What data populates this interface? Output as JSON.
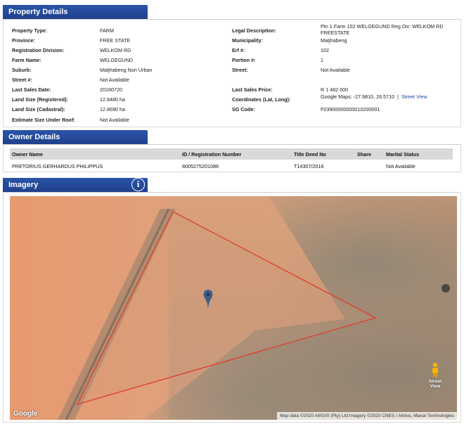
{
  "sections": {
    "property_details": "Property Details",
    "owner_details": "Owner Details",
    "imagery": "Imagery"
  },
  "property": {
    "left": [
      {
        "label": "Property Type:",
        "value": "FARM"
      },
      {
        "label": "Province:",
        "value": "FREE STATE"
      },
      {
        "label": "Registration Division:",
        "value": "WELKOM RD"
      },
      {
        "label": "Farm Name:",
        "value": "WELGEGUND"
      },
      {
        "label": "Suburb:",
        "value": "Matjhabeng Non Urban"
      },
      {
        "label": "Street #:",
        "value": "Not Available"
      },
      {
        "label": "Last Sales Date:",
        "value": "20160720"
      },
      {
        "label": "Land Size (Registered):",
        "value": "12.8480 ha"
      },
      {
        "label": "Land Size (Cadastral):",
        "value": "12.8690 ha"
      },
      {
        "label": "Estimate Size Under Roof:",
        "value": "Not Available"
      }
    ],
    "right": [
      {
        "label": "Legal Description:",
        "value": "Ptn 1 Farm 102 WELGEGUND Reg Div: WELKOM RD FREESTATE"
      },
      {
        "label": "Municipality:",
        "value": "Matjhabeng"
      },
      {
        "label": "Erf #:",
        "value": "102"
      },
      {
        "label": "Portion #:",
        "value": "1"
      },
      {
        "label": "Street:",
        "value": "Not Available"
      },
      {
        "label": "Last Sales Price:",
        "value": "R 1 482 000"
      },
      {
        "label": "Coordinates (Lat, Long):",
        "value": "Google Maps: -27.9810, 26.5710",
        "separator": "|",
        "link": "Street View"
      },
      {
        "label": "SG Code:",
        "value": "F03900000000010200001"
      }
    ]
  },
  "owners": {
    "columns": [
      "Owner Name",
      "ID / Registration Number",
      "Title Deed No",
      "Share",
      "Marital Status"
    ],
    "rows": [
      {
        "name": "PRETORIUS GERHARDUS PHILIPPUS",
        "id": "8005275201086",
        "deed": "T14307/2016",
        "share": "",
        "marital": "Not Available"
      }
    ]
  },
  "map": {
    "google_logo": "Google",
    "attribution": "Map data ©2020 AfriGIS (Pty) Ltd Imagery ©2020 CNES / Airbus, Maxar Technologies",
    "street_view_label_1": "Street",
    "street_view_label_2": "View",
    "info_icon": "i",
    "boundary_color": "#e03a2a",
    "marker_color": "#3b5f86"
  }
}
